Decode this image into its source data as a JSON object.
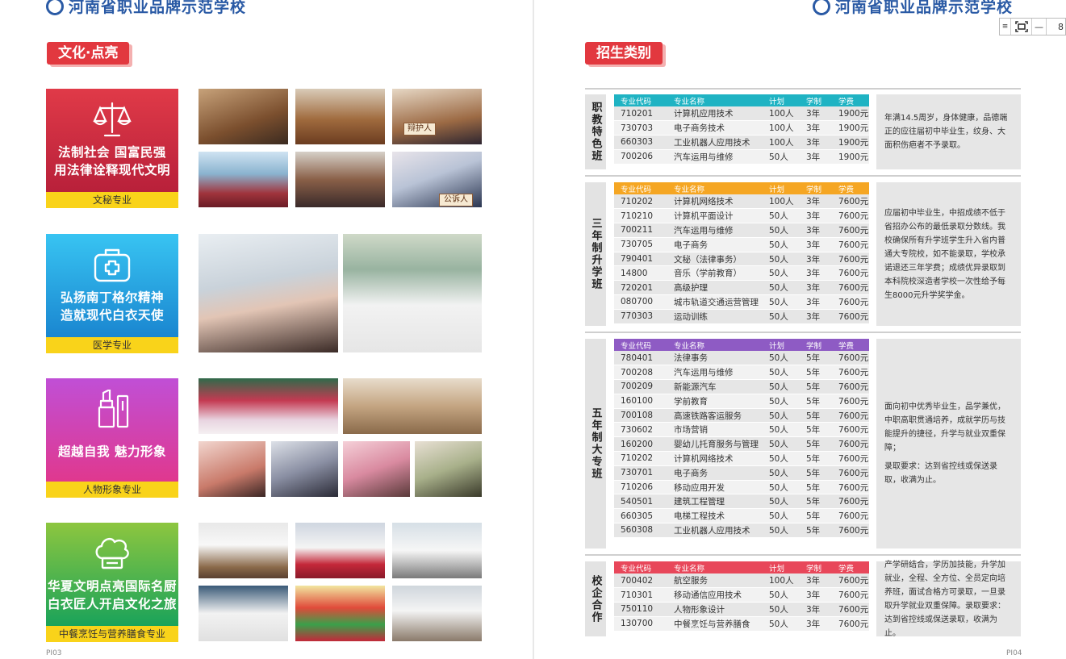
{
  "school_name": "河南省职业品牌示范学校",
  "left_page": {
    "section_title": "文化·点亮",
    "page_number": "PI03",
    "categories": [
      {
        "slogan_lines": [
          "法制社会  国富民强",
          "用法律诠释现代文明"
        ],
        "label": "文秘专业",
        "icon": "scales-icon",
        "color_top": "#e03a48",
        "color_bottom": "#b8203a"
      },
      {
        "slogan_lines": [
          "弘扬南丁格尔精神",
          "造就现代白衣天使"
        ],
        "label": "医学专业",
        "icon": "medical-kit-icon",
        "color_top": "#35c2f0",
        "color_bottom": "#1a86d0"
      },
      {
        "slogan_lines": [
          "超越自我  魅力形象"
        ],
        "label": "人物形象专业",
        "icon": "lipstick-icon",
        "color_top": "#c04fd6",
        "color_bottom": "#e0388e"
      },
      {
        "slogan_lines": [
          "华夏文明点亮国际名厨",
          "白衣匠人开启文化之旅"
        ],
        "label": "中餐烹饪与营养膳食专业",
        "icon": "chef-hat-icon",
        "color_top": "#8dc63f",
        "color_bottom": "#1aa35a"
      }
    ],
    "photo_signs": {
      "defense_sign": "辩护人",
      "prosecutor_sign": "公诉人"
    }
  },
  "right_page": {
    "section_title": "招生类别",
    "page_number": "PI04",
    "zoom_value": "8",
    "table_headers": [
      "专业代码",
      "专业名称",
      "计划",
      "学制",
      "学费"
    ],
    "blocks": [
      {
        "title": "职教特色班",
        "header_color": "#1fb3c3",
        "rows": [
          [
            "710201",
            "计算机应用技术",
            "100人",
            "3年",
            "1900元"
          ],
          [
            "730703",
            "电子商务技术",
            "100人",
            "3年",
            "1900元"
          ],
          [
            "660303",
            "工业机器人应用技术",
            "100人",
            "3年",
            "1900元"
          ],
          [
            "700206",
            "汽车运用与维修",
            "50人",
            "3年",
            "1900元"
          ]
        ],
        "description": [
          "年满14.5周岁，身体健康，品德端正的应往届初中毕业生，纹身、大面积伤疤者不予录取。"
        ]
      },
      {
        "title": "三年制升学班",
        "header_color": "#f5a623",
        "rows": [
          [
            "710202",
            "计算机网络技术",
            "100人",
            "3年",
            "7600元"
          ],
          [
            "710210",
            "计算机平面设计",
            "50人",
            "3年",
            "7600元"
          ],
          [
            "700211",
            "汽车运用与维修",
            "50人",
            "3年",
            "7600元"
          ],
          [
            "730705",
            "电子商务",
            "50人",
            "3年",
            "7600元"
          ],
          [
            "790401",
            "文秘（法律事务）",
            "50人",
            "3年",
            "7600元"
          ],
          [
            "14800",
            "音乐（学前教育）",
            "50人",
            "3年",
            "7600元"
          ],
          [
            "720201",
            "高级护理",
            "50人",
            "3年",
            "7600元"
          ],
          [
            "080700",
            "城市轨道交通运营管理",
            "50人",
            "3年",
            "7600元"
          ],
          [
            "770303",
            "运动训练",
            "50人",
            "3年",
            "7600元"
          ]
        ],
        "description": [
          "应届初中毕业生，中招成绩不低于省招办公布的最低录取分数线。我校确保所有升学班学生升入省内普通大专院校，如不能录取，学校承诺退还三年学费；成绩优异录取到本科院校深造者学校一次性给予每生8000元升学奖学金。"
        ]
      },
      {
        "title": "五年制大专班",
        "header_color": "#8e5bc4",
        "rows": [
          [
            "780401",
            "法律事务",
            "50人",
            "5年",
            "7600元"
          ],
          [
            "700208",
            "汽车运用与维修",
            "50人",
            "5年",
            "7600元"
          ],
          [
            "700209",
            "新能源汽车",
            "50人",
            "5年",
            "7600元"
          ],
          [
            "160100",
            "学前教育",
            "50人",
            "5年",
            "7600元"
          ],
          [
            "700108",
            "高速铁路客运服务",
            "50人",
            "5年",
            "7600元"
          ],
          [
            "730602",
            "市场营销",
            "50人",
            "5年",
            "7600元"
          ],
          [
            "160200",
            "婴幼儿托育服务与管理",
            "50人",
            "5年",
            "7600元"
          ],
          [
            "710202",
            "计算机网络技术",
            "50人",
            "5年",
            "7600元"
          ],
          [
            "730701",
            "电子商务",
            "50人",
            "5年",
            "7600元"
          ],
          [
            "710206",
            "移动应用开发",
            "50人",
            "5年",
            "7600元"
          ],
          [
            "540501",
            "建筑工程管理",
            "50人",
            "5年",
            "7600元"
          ],
          [
            "660305",
            "电梯工程技术",
            "50人",
            "5年",
            "7600元"
          ],
          [
            "560308",
            "工业机器人应用技术",
            "50人",
            "5年",
            "7600元"
          ]
        ],
        "description": [
          "面向初中优秀毕业生，品学兼优，中职高职贯通培养，成就学历与技能提升的捷径，升学与就业双重保障；",
          "录取要求：达到省控线或保送录取，收满为止。"
        ]
      },
      {
        "title": "校企合作",
        "header_color": "#e8475a",
        "rows": [
          [
            "700402",
            "航空服务",
            "100人",
            "3年",
            "7600元"
          ],
          [
            "710301",
            "移动通信应用技术",
            "50人",
            "3年",
            "7600元"
          ],
          [
            "750110",
            "人物形象设计",
            "50人",
            "3年",
            "7600元"
          ],
          [
            "130700",
            "中餐烹饪与营养膳食",
            "50人",
            "3年",
            "7600元"
          ]
        ],
        "description": [
          "产学研结合，学历加技能，升学加就业，全程、全方位、全员定向培养班，面试合格方可录取，一旦录取升学就业双重保障。录取要求：达到省控线或保送录取，收满为止。"
        ]
      }
    ]
  }
}
